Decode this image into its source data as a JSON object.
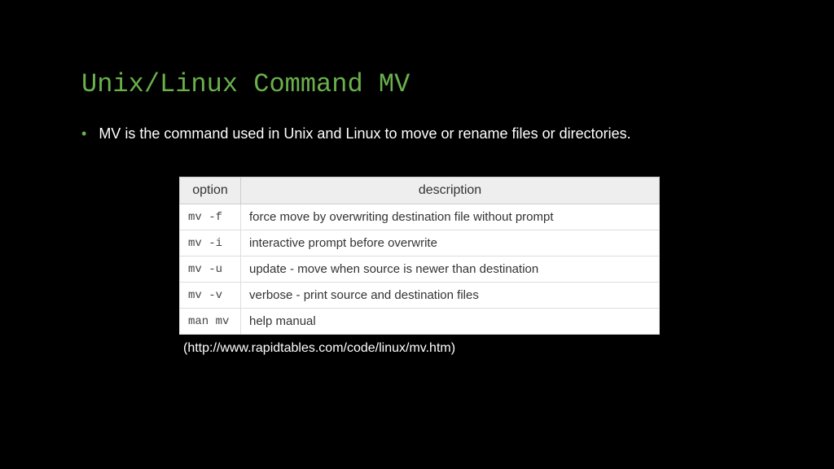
{
  "title": "Unix/Linux Command MV",
  "bullet": "MV is the command used in Unix and Linux to move or rename files or directories.",
  "table": {
    "headers": {
      "option": "option",
      "description": "description"
    },
    "rows": [
      {
        "option": "mv -f",
        "description": "force move by overwriting destination file without prompt"
      },
      {
        "option": "mv -i",
        "description": "interactive prompt before overwrite"
      },
      {
        "option": "mv -u",
        "description": "update - move when source is newer than destination"
      },
      {
        "option": "mv -v",
        "description": "verbose - print source and destination files"
      },
      {
        "option": "man mv",
        "description": "help manual"
      }
    ]
  },
  "citation": "(http://www.rapidtables.com/code/linux/mv.htm)"
}
